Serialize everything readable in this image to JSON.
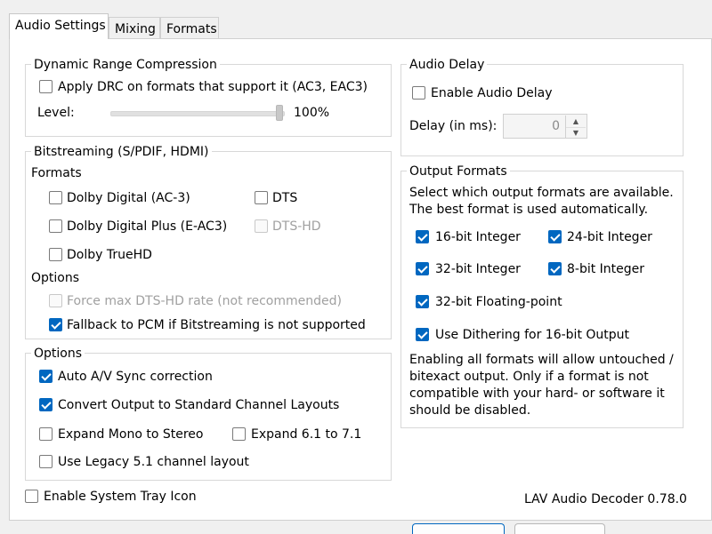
{
  "tabs": [
    "Audio Settings",
    "Mixing",
    "Formats"
  ],
  "drc": {
    "legend": "Dynamic Range Compression",
    "apply_label": "Apply DRC on formats that support it (AC3, EAC3)",
    "apply_checked": false,
    "level_label": "Level:",
    "level_value": "100%",
    "level_fraction": 1.0
  },
  "bitstream": {
    "legend": "Bitstreaming (S/PDIF, HDMI)",
    "formats_label": "Formats",
    "dolby_digital": "Dolby Digital (AC-3)",
    "dts": "DTS",
    "dolby_digital_plus": "Dolby Digital Plus (E-AC3)",
    "dts_hd": "DTS-HD",
    "dolby_truehd": "Dolby TrueHD",
    "options_label": "Options",
    "force_max_dtshd": "Force max DTS-HD rate (not recommended)",
    "fallback_pcm": "Fallback to PCM if Bitstreaming is not supported"
  },
  "options": {
    "legend": "Options",
    "auto_av_sync": "Auto A/V Sync correction",
    "convert_output": "Convert Output to Standard Channel Layouts",
    "expand_mono": "Expand Mono to Stereo",
    "expand_61": "Expand 6.1 to 7.1",
    "legacy_51": "Use Legacy 5.1 channel layout"
  },
  "audio_delay": {
    "legend": "Audio Delay",
    "enable_label": "Enable Audio Delay",
    "delay_label": "Delay (in ms):",
    "delay_value": "0"
  },
  "output_formats": {
    "legend": "Output Formats",
    "description_line1": "Select which output formats are available.",
    "description_line2": "The best format is used automatically.",
    "int16": "16-bit Integer",
    "int24": "24-bit Integer",
    "int32": "32-bit Integer",
    "int8": "8-bit Integer",
    "float32": "32-bit Floating-point",
    "dithering": "Use Dithering for 16-bit Output",
    "note_line1": "Enabling all formats will allow untouched /",
    "note_line2": "bitexact output. Only if a format is not",
    "note_line3": "compatible with your hard- or software it",
    "note_line4": "should be disabled."
  },
  "footer": {
    "tray_label": "Enable System Tray Icon",
    "version": "LAV Audio Decoder 0.78.0"
  },
  "colors": {
    "accent": "#0067c0",
    "background": "#f0f0f0",
    "panel": "#ffffff"
  }
}
